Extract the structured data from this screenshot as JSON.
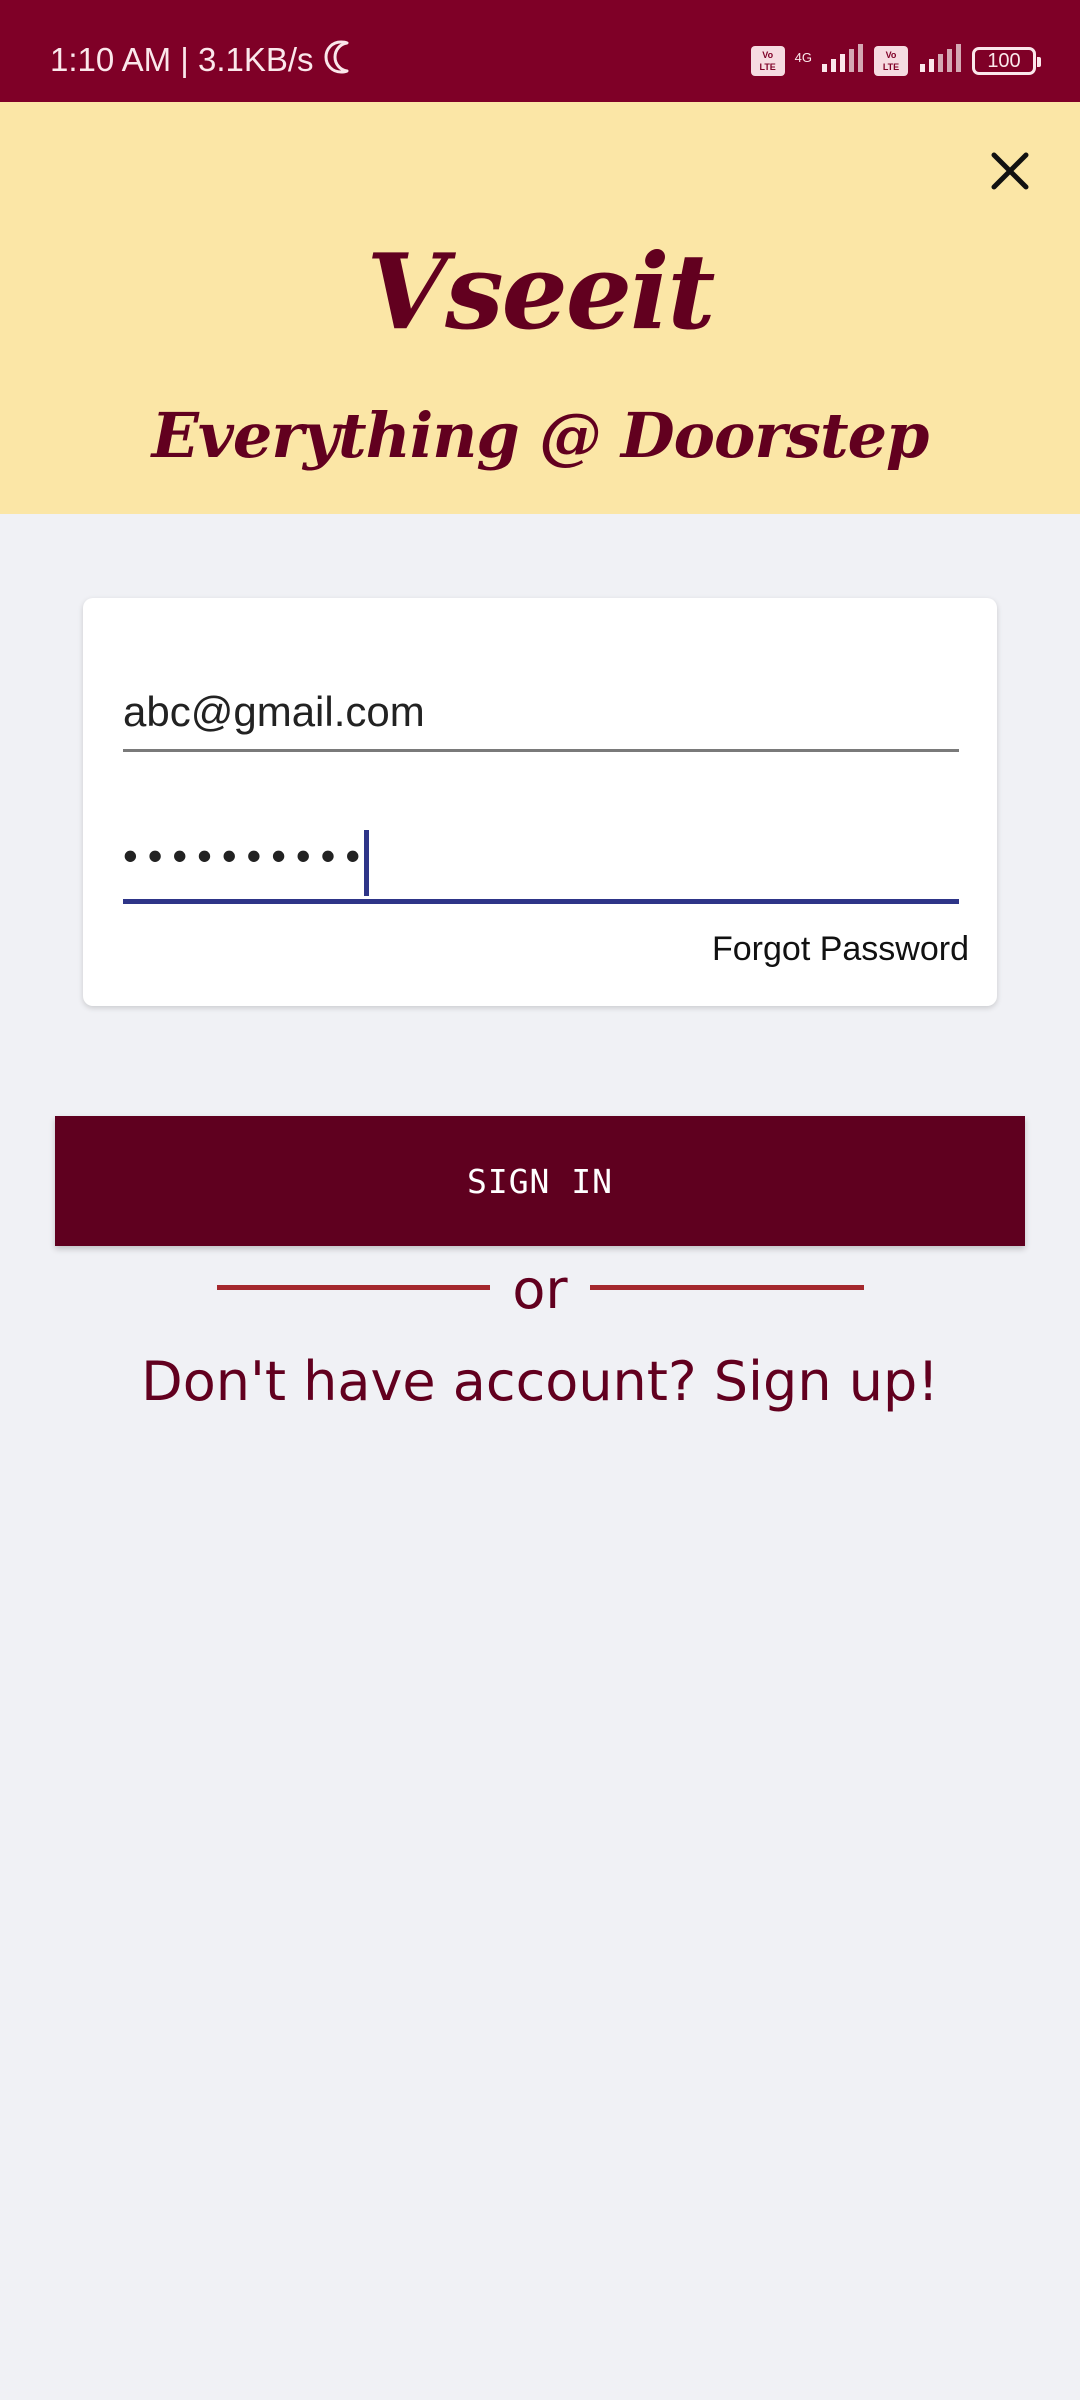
{
  "status_bar": {
    "time_speed": "1:10 AM | 3.1KB/s",
    "battery_level": "100",
    "network_type": "4G",
    "volte_label": "Vo\nLTE",
    "icons": [
      "moon-icon",
      "volte-icon",
      "signal-icon",
      "battery-icon"
    ]
  },
  "header": {
    "brand": "Vseeit",
    "tagline": "Everything @ Doorstep",
    "close_icon": "close-icon"
  },
  "form": {
    "email_value": "abc@gmail.com",
    "password_masked": "••••••••••",
    "forgot_label": "Forgot Password"
  },
  "actions": {
    "sign_in_label": "SIGN IN",
    "or_label": "or",
    "signup_label": "Don't have account? Sign up!"
  },
  "colors": {
    "status_bar": "#7f0027",
    "header_bg": "#fbe6a6",
    "brand_text": "#62001f",
    "page_bg": "#f0f1f5",
    "primary_button": "#5f001f",
    "focused_underline": "#2e3588",
    "divider": "#a4282d"
  }
}
